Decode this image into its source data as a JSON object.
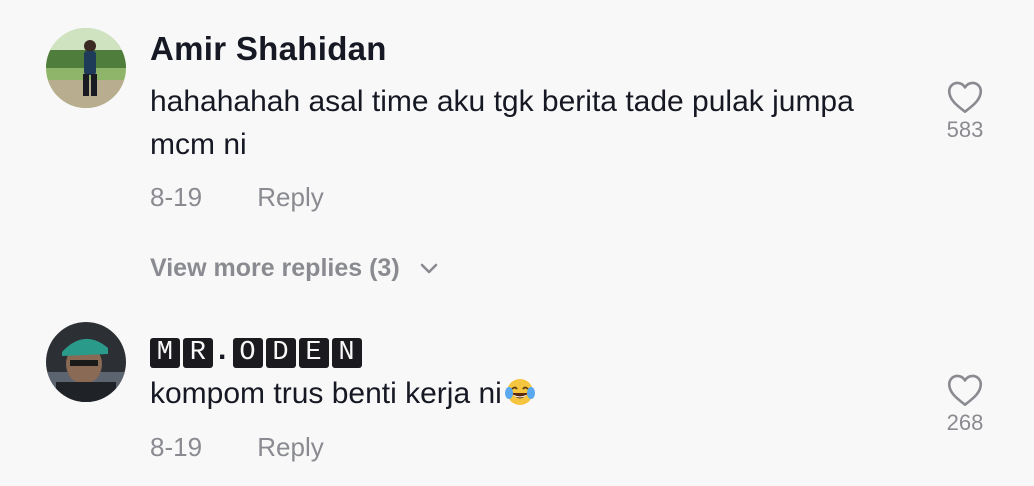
{
  "comments": [
    {
      "username": "Amir Shahidan",
      "text": "hahahahah asal time aku tgk berita tade pulak jumpa mcm ni",
      "date": "8-19",
      "reply_label": "Reply",
      "likes": "583",
      "avatar_icon": "user-photo-avatar"
    },
    {
      "username_chars": [
        "M",
        "R",
        ".",
        "O",
        "D",
        "E",
        "N"
      ],
      "text": "kompom trus benti kerja ni",
      "emoji": "face-with-tears-of-joy",
      "date": "8-19",
      "reply_label": "Reply",
      "likes": "268",
      "avatar_icon": "user-photo-avatar"
    }
  ],
  "view_more_replies": "View more replies (3)",
  "colors": {
    "background": "#f8f8f8",
    "primary_text": "#161823",
    "secondary_text": "#8a8b91"
  }
}
